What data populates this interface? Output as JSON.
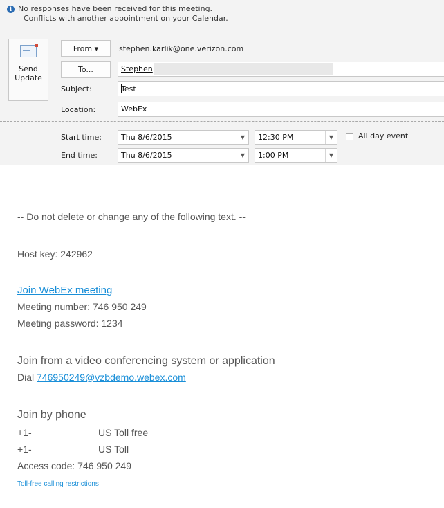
{
  "info": {
    "line1": "No responses have been received for this meeting.",
    "line2": "Conflicts with another appointment on your Calendar."
  },
  "send": {
    "line1": "Send",
    "line2": "Update"
  },
  "from": {
    "button": "From ▾",
    "email": "stephen.karlik@one.verizon.com"
  },
  "to": {
    "button": "To...",
    "value": "Stephen"
  },
  "subject": {
    "label": "Subject:",
    "value": "Test"
  },
  "location": {
    "label": "Location:",
    "value": "WebEx"
  },
  "start": {
    "label": "Start time:",
    "date": "Thu 8/6/2015",
    "time": "12:30 PM"
  },
  "end": {
    "label": "End time:",
    "date": "Thu 8/6/2015",
    "time": "1:00 PM"
  },
  "all_day": "All day event",
  "body": {
    "notice": "-- Do not delete or change any of the following text. --",
    "host_key": "Host key: 242962",
    "join_link": "Join WebEx meeting",
    "meeting_number": "Meeting number: 746 950 249",
    "meeting_password": "Meeting password: 1234",
    "video_heading": "Join from a video conferencing system or application",
    "dial_prefix": "Dial ",
    "dial_address": "746950249@vzbdemo.webex.com",
    "phone_heading": "Join by phone",
    "phone1_prefix": "+1-",
    "phone1_label": "US Toll free",
    "phone2_prefix": "+1-",
    "phone2_label": "US Toll",
    "access_code": "Access code: 746 950 249",
    "restrictions": "Toll-free calling restrictions"
  },
  "colors": {
    "link": "#1a8fd8",
    "info_icon": "#2b6cb3",
    "header_bg": "#f3f3f3"
  }
}
